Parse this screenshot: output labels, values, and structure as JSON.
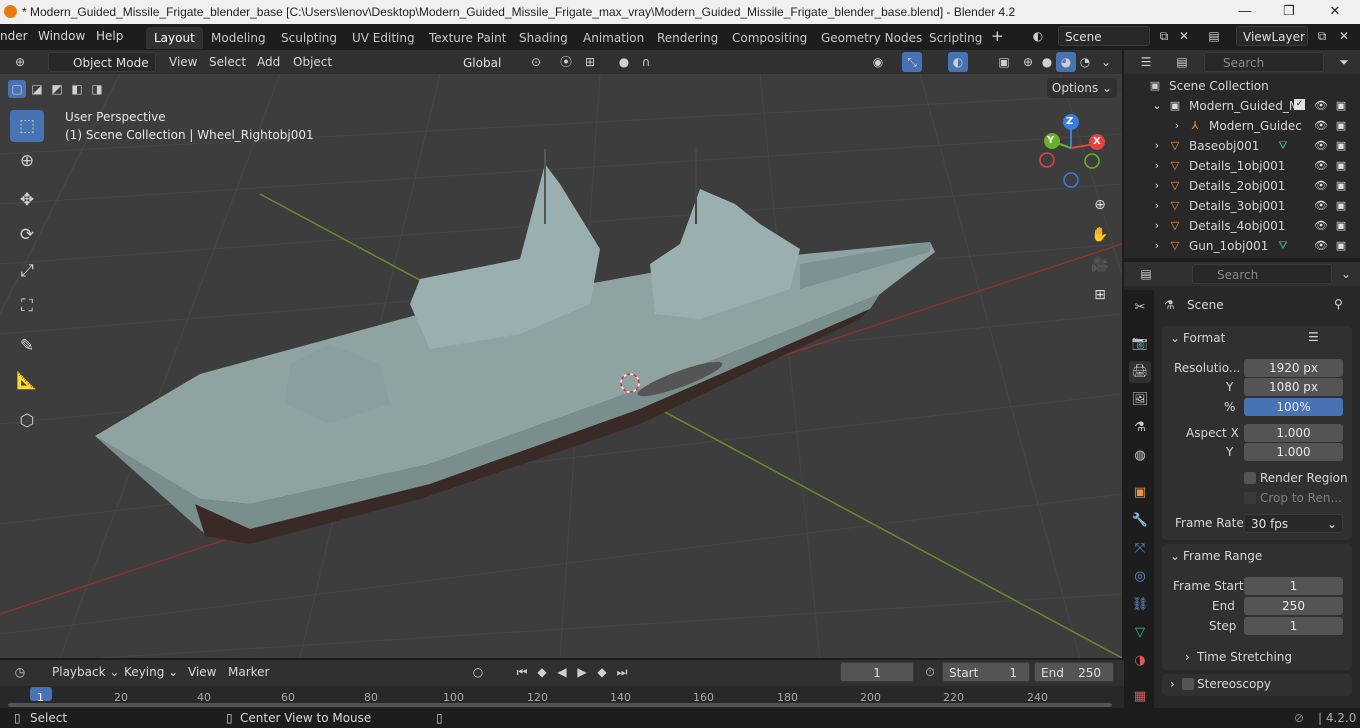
{
  "window": {
    "title": "* Modern_Guided_Missile_Frigate_blender_base [C:\\Users\\lenov\\Desktop\\Modern_Guided_Missile_Frigate_max_vray\\Modern_Guided_Missile_Frigate_blender_base.blend] - Blender 4.2",
    "minimize": "—",
    "maximize": "❐",
    "close": "✕"
  },
  "menu": {
    "render": "nder",
    "window": "Window",
    "help": "Help"
  },
  "workspaces": [
    "Layout",
    "Modeling",
    "Sculpting",
    "UV Editing",
    "Texture Paint",
    "Shading",
    "Animation",
    "Rendering",
    "Compositing",
    "Geometry Nodes",
    "Scripting"
  ],
  "scene_field": "Scene",
  "viewlayer_field": "ViewLayer",
  "viewport_header": {
    "mode": "Object Mode",
    "view": "View",
    "select": "Select",
    "add": "Add",
    "object": "Object",
    "transform": "Global",
    "options": "Options"
  },
  "viewport": {
    "perspective": "User Perspective",
    "collection_info": "(1) Scene Collection | Wheel_Rightobj001",
    "gizmo": {
      "z": "Z",
      "y": "Y",
      "x": "X"
    }
  },
  "outliner": {
    "search_placeholder": "Search",
    "root": "Scene Collection",
    "items": [
      {
        "label": "Modern_Guided_M"
      },
      {
        "label": "Modern_Guidec"
      },
      {
        "label": "Baseobj001"
      },
      {
        "label": "Details_1obj001"
      },
      {
        "label": "Details_2obj001"
      },
      {
        "label": "Details_3obj001"
      },
      {
        "label": "Details_4obj001"
      },
      {
        "label": "Gun_1obj001"
      }
    ]
  },
  "properties": {
    "search_placeholder": "Search",
    "context": "Scene",
    "format": {
      "title": "Format",
      "resolution_label": "Resolutio...",
      "res_x": "1920 px",
      "y_label": "Y",
      "res_y": "1080 px",
      "pct_label": "%",
      "pct": "100%",
      "aspect_x_label": "Aspect X",
      "aspect_x": "1.000",
      "aspect_y_label": "Y",
      "aspect_y": "1.000",
      "render_region": "Render Region",
      "crop": "Crop to Ren...",
      "frame_rate_label": "Frame Rate",
      "frame_rate": "30 fps"
    },
    "frame_range": {
      "title": "Frame Range",
      "start_label": "Frame Start",
      "start": "1",
      "end_label": "End",
      "end": "250",
      "step_label": "Step",
      "step": "1"
    },
    "time_stretching": "Time Stretching",
    "stereoscopy": "Stereoscopy"
  },
  "timeline": {
    "playback": "Playback",
    "keying": "Keying",
    "view": "View",
    "marker": "Marker",
    "current_frame": "1",
    "start_label": "Start",
    "start": "1",
    "end_label": "End",
    "end": "250",
    "ruler": [
      "1",
      "20",
      "40",
      "60",
      "80",
      "100",
      "120",
      "140",
      "160",
      "180",
      "200",
      "220",
      "240"
    ]
  },
  "status": {
    "select": "Select",
    "center_view": "Center View to Mouse",
    "version": "4.2.0"
  }
}
